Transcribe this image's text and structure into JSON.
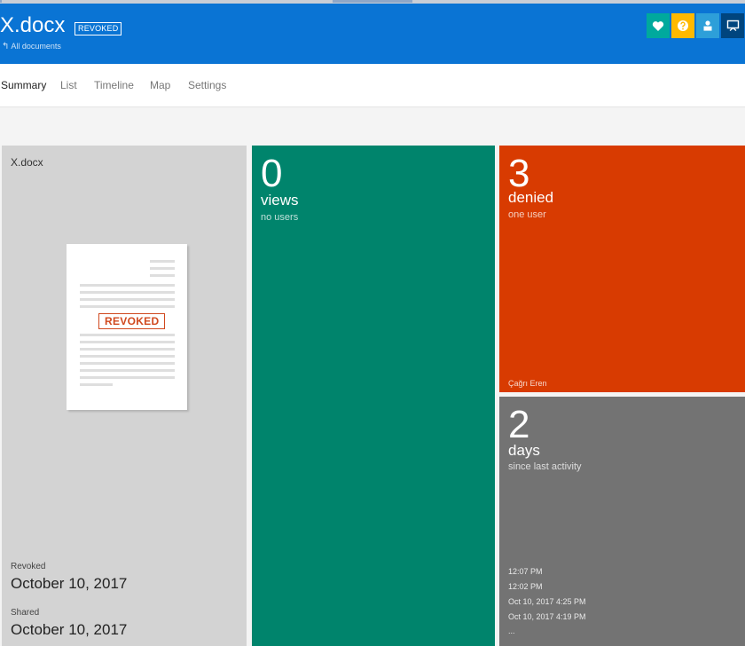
{
  "header": {
    "title": "X.docx",
    "status_badge": "REVOKED",
    "back_link": "All documents",
    "bg_color": "#0a74d4",
    "buttons": [
      {
        "icon": "heart-icon",
        "color": "#00a99d"
      },
      {
        "icon": "help-icon",
        "color": "#ffb900"
      },
      {
        "icon": "user-icon",
        "color": "#2d9fd9"
      },
      {
        "icon": "present-icon",
        "color": "#00457e"
      }
    ]
  },
  "nav": {
    "tabs": [
      {
        "label": "Summary",
        "active": true
      },
      {
        "label": "List",
        "active": false
      },
      {
        "label": "Timeline",
        "active": false
      },
      {
        "label": "Map",
        "active": false
      },
      {
        "label": "Settings",
        "active": false
      }
    ]
  },
  "document_tile": {
    "name": "X.docx",
    "preview_stamp": "REVOKED",
    "revoked_label": "Revoked",
    "revoked_date": "October 10, 2017",
    "shared_label": "Shared",
    "shared_date": "October 10, 2017"
  },
  "views_tile": {
    "count": "0",
    "unit": "views",
    "subtitle": "no users",
    "color": "#00846c"
  },
  "denied_tile": {
    "count": "3",
    "unit": "denied",
    "subtitle": "one user",
    "user": "Çağrı Eren",
    "color": "#d83b01"
  },
  "days_tile": {
    "count": "2",
    "unit": "days",
    "subtitle": "since last activity",
    "activity": [
      "12:07 PM",
      "12:02 PM",
      "Oct 10, 2017 4:25 PM",
      "Oct 10, 2017 4:19 PM",
      "..."
    ],
    "color": "#737373"
  }
}
